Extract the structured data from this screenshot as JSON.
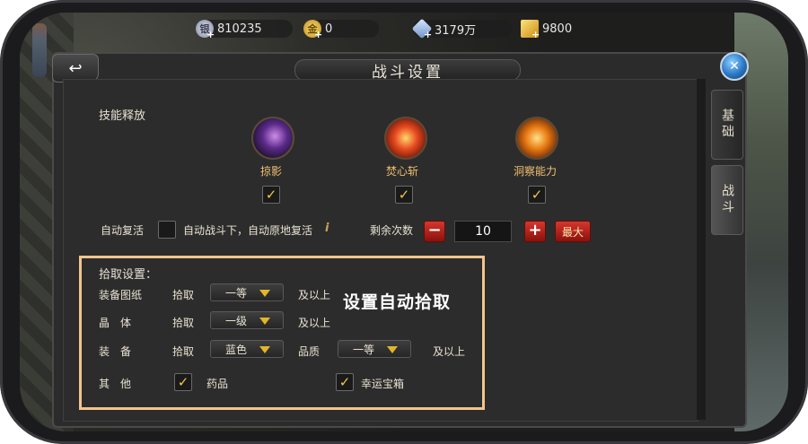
{
  "currencies": [
    {
      "name": "silver-coin",
      "value": "810235"
    },
    {
      "name": "gold-coin",
      "value": "0"
    },
    {
      "name": "diamond",
      "value": "3179万"
    },
    {
      "name": "gold-ingot",
      "value": "9800"
    }
  ],
  "dialog": {
    "title": "战斗设置",
    "tabs": [
      "基础",
      "战斗"
    ],
    "active_tab": "战斗"
  },
  "skills": {
    "section_label": "技能释放",
    "items": [
      {
        "name": "掠影",
        "checked": true
      },
      {
        "name": "焚心斩",
        "checked": true
      },
      {
        "name": "洞察能力",
        "checked": true
      }
    ]
  },
  "revive": {
    "label": "自动复活",
    "checked": false,
    "description": "自动战斗下，自动原地复活",
    "remaining_label": "剩余次数",
    "count": "10",
    "max_label": "最大"
  },
  "pickup": {
    "section_label": "拾取设置：",
    "callout": "设置自动拾取",
    "rows": [
      {
        "label": "装备图纸",
        "action": "拾取",
        "dropdown": "一等",
        "suffix": "及以上"
      },
      {
        "label": "晶　体",
        "action": "拾取",
        "dropdown": "一级",
        "suffix": "及以上"
      },
      {
        "label": "装　备",
        "action": "拾取",
        "dropdown": "蓝色",
        "quality_label": "品质",
        "quality_dropdown": "一等",
        "suffix": "及以上"
      }
    ],
    "other": {
      "label": "其　他",
      "options": [
        {
          "name": "药品",
          "checked": true
        },
        {
          "name": "幸运宝箱",
          "checked": true
        }
      ]
    }
  },
  "colors": {
    "highlight_border": "#f3c48d",
    "accent_gold": "#f3c44a",
    "red_button": "#d6362d"
  }
}
